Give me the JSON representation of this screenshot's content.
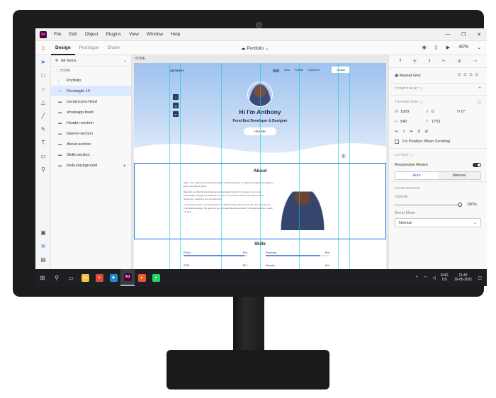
{
  "titlebar": {
    "app_icon": "Xd",
    "menu": [
      "File",
      "Edit",
      "Object",
      "Plugins",
      "View",
      "Window",
      "Help"
    ],
    "controls": [
      "—",
      "❐",
      "✕"
    ]
  },
  "toolbar": {
    "tabs": [
      "Design",
      "Prototype",
      "Share"
    ],
    "doc_title": "Portfolio",
    "zoom": "40%"
  },
  "layers": {
    "filter": "All Items",
    "breadcrumb": "HOME",
    "items": [
      {
        "label": "Portfolio",
        "icon": "back-icon"
      },
      {
        "label": "Rectangle 14",
        "icon": "rectangle-icon"
      },
      {
        "label": "social-icons-fixed",
        "icon": "folder-icon"
      },
      {
        "label": "whatsapp-fixed",
        "icon": "folder-icon"
      },
      {
        "label": "Header-section",
        "icon": "folder-icon"
      },
      {
        "label": "banner-section",
        "icon": "folder-icon"
      },
      {
        "label": "About-section",
        "icon": "folder-icon"
      },
      {
        "label": "Skills-section",
        "icon": "folder-icon"
      },
      {
        "label": "body-background",
        "icon": "folder-icon"
      }
    ]
  },
  "artboard": {
    "label": "HOME",
    "nav": {
      "logo": "ANTHONY",
      "links": [
        "Home",
        "Skills",
        "Portfolio",
        "Experience"
      ],
      "contact": "Contact"
    },
    "social_icons": [
      "f",
      "◎",
      "in"
    ],
    "hero": {
      "title": "Hi I'm Anthony",
      "subtitle": "Front End Developer & Designer",
      "button": "Hire Me"
    },
    "about": {
      "title": "About",
      "paragraphs": [
        "Hello ! I am Anthony, Front End Developer & UI/UX Designer. I'm always energetic and eager to learn new skills & Quick.",
        "Basically i am Mechanical Engineering Graduated but all of my Interest only in web technologies, designing & development. I am very curious i to learn and work on web developing, designing and programming.",
        "I'm YouTube learner, i've learned all of my skills through internet. Currently i am working as a Front End Developer. My goal is to be a full stack Developer ASAP. I'm hardly working to reach my goal."
      ]
    },
    "skills": {
      "title": "Skills",
      "items": [
        {
          "name": "HTML5",
          "pct_label": "95%",
          "level": 95
        },
        {
          "name": "Photoshop",
          "pct_label": "85%",
          "level": 85
        },
        {
          "name": "CSS3",
          "pct_label": "85%",
          "level": 85
        },
        {
          "name": "Illustrator",
          "pct_label": "40%",
          "level": 40
        }
      ]
    }
  },
  "properties": {
    "repeat_grid": "Repeat Grid",
    "component": "COMPONENT",
    "transform": "TRANSFORM",
    "w_label": "W",
    "w": "1920",
    "x_label": "X",
    "x": "0",
    "rotation": "0°",
    "h_label": "H",
    "h": "540",
    "y_label": "Y",
    "y": "1753",
    "fix_position": "Fix Position When Scrolling",
    "layout": "LAYOUT",
    "responsive_resize": "Responsive Resize",
    "auto": "Auto",
    "manual": "Manual",
    "appearance": "APPEARANCE",
    "opacity_label": "Opacity",
    "opacity": "100%",
    "blend_label": "Blend Mode",
    "blend": "Normal"
  },
  "taskbar": {
    "apps": [
      {
        "name": "file-explorer",
        "glyph": "▬",
        "color": "#f3c43d"
      },
      {
        "name": "chrome",
        "glyph": "●",
        "color": "#dd4b3e"
      },
      {
        "name": "vscode",
        "glyph": "◆",
        "color": "#1f8ad2"
      },
      {
        "name": "xd",
        "glyph": "Xd",
        "color": "#470137"
      },
      {
        "name": "brave",
        "glyph": "▲",
        "color": "#f05a28"
      },
      {
        "name": "whatsapp",
        "glyph": "●",
        "color": "#25d366"
      }
    ],
    "lang_top": "ENG",
    "lang_bottom": "US",
    "time": "11:46",
    "date": "16-05-2021"
  }
}
